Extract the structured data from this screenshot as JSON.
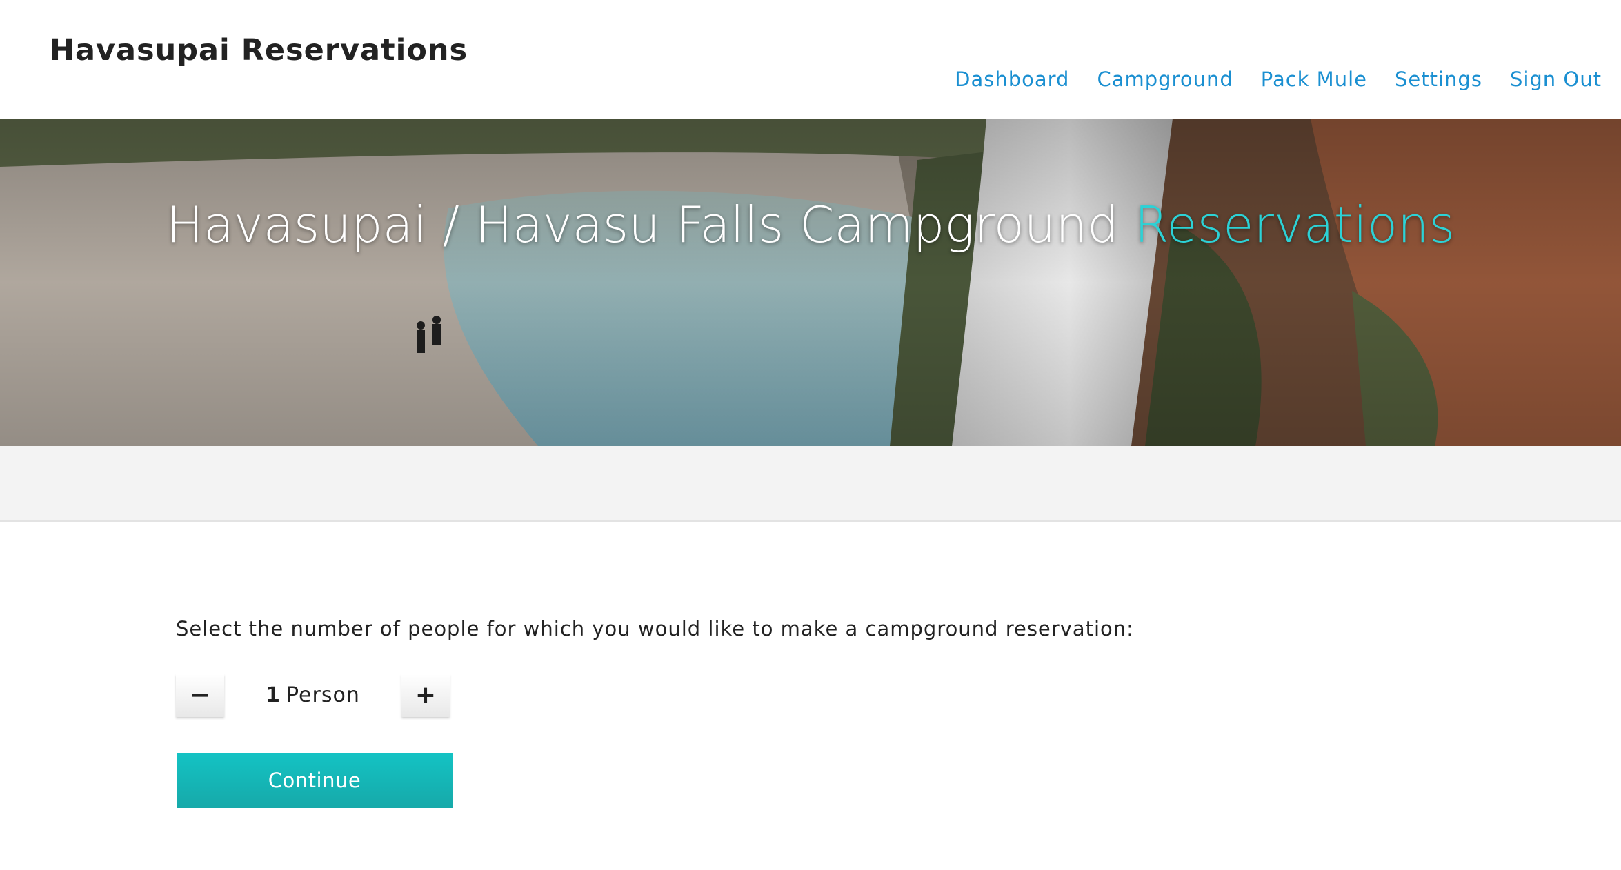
{
  "header": {
    "brand": "Havasupai Reservations",
    "nav": [
      {
        "label": "Dashboard"
      },
      {
        "label": "Campground"
      },
      {
        "label": "Pack Mule"
      },
      {
        "label": "Settings"
      },
      {
        "label": "Sign Out"
      }
    ]
  },
  "hero": {
    "title_main": "Havasupai / Havasu Falls Campground ",
    "title_accent": "Reservations"
  },
  "reservation": {
    "prompt": "Select the number of people for which you would like to make a campground reservation:",
    "minus_symbol": "−",
    "plus_symbol": "+",
    "count": "1",
    "unit": "Person",
    "continue_label": "Continue"
  },
  "colors": {
    "nav_link": "#1a8fd1",
    "accent_teal": "#2cd2d6",
    "button_teal": "#14b8b8",
    "band_gray": "#f3f3f3"
  }
}
